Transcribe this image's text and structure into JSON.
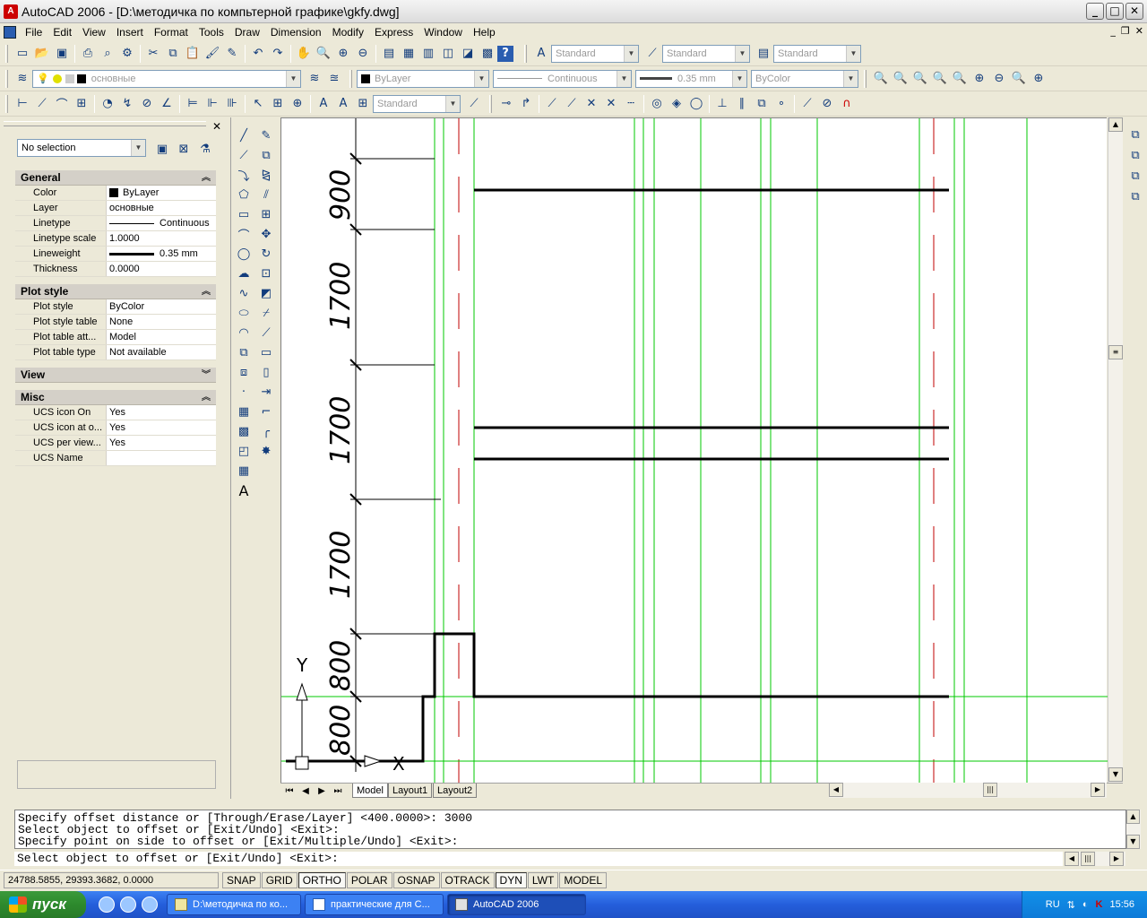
{
  "window": {
    "title": "AutoCAD 2006 - [D:\\методичка по компьтерной графике\\gkfy.dwg]",
    "app_icon": "A"
  },
  "menu": [
    "File",
    "Edit",
    "View",
    "Insert",
    "Format",
    "Tools",
    "Draw",
    "Dimension",
    "Modify",
    "Express",
    "Window",
    "Help"
  ],
  "styles_toolbar": {
    "text_style": "Standard",
    "dim_style": "Standard",
    "table_style": "Standard"
  },
  "layers_toolbar": {
    "layer": "основные"
  },
  "properties_toolbar": {
    "color": "ByLayer",
    "linetype": "Continuous",
    "lineweight": "0.35 mm",
    "plotstyle": "ByColor"
  },
  "dim_toolbar": {
    "dim_style": "Standard"
  },
  "properties_palette": {
    "selection": "No selection",
    "general": {
      "title": "General",
      "rows": [
        {
          "k": "Color",
          "v": "ByLayer"
        },
        {
          "k": "Layer",
          "v": "основные"
        },
        {
          "k": "Linetype",
          "v": "Continuous"
        },
        {
          "k": "Linetype scale",
          "v": "1.0000"
        },
        {
          "k": "Lineweight",
          "v": "0.35 mm"
        },
        {
          "k": "Thickness",
          "v": "0.0000"
        }
      ]
    },
    "plot": {
      "title": "Plot style",
      "rows": [
        {
          "k": "Plot style",
          "v": "ByColor"
        },
        {
          "k": "Plot style table",
          "v": "None"
        },
        {
          "k": "Plot table att...",
          "v": "Model"
        },
        {
          "k": "Plot table type",
          "v": "Not available"
        }
      ]
    },
    "view": {
      "title": "View"
    },
    "misc": {
      "title": "Misc",
      "rows": [
        {
          "k": "UCS icon On",
          "v": "Yes"
        },
        {
          "k": "UCS icon at o...",
          "v": "Yes"
        },
        {
          "k": "UCS per view...",
          "v": "Yes"
        },
        {
          "k": "UCS Name",
          "v": ""
        }
      ]
    }
  },
  "drawing": {
    "dims": [
      "900",
      "1700",
      "1700",
      "1700",
      "800",
      "800"
    ],
    "ucs": {
      "y": "Y",
      "x": "X"
    },
    "colors": {
      "lines": "#000000",
      "grid": "#00c800",
      "axis": "#c00000"
    }
  },
  "layout_tabs": [
    "Model",
    "Layout1",
    "Layout2"
  ],
  "command": {
    "history": [
      "Specify offset distance or [Through/Erase/Layer] <400.0000>: 3000",
      "Select object to offset or [Exit/Undo] <Exit>:",
      "Specify point on side to offset or [Exit/Multiple/Undo] <Exit>:"
    ],
    "prompt": "Select object to offset or [Exit/Undo] <Exit>:"
  },
  "status": {
    "coords": "24788.5855, 29393.3682, 0.0000",
    "buttons": [
      {
        "label": "SNAP",
        "on": false
      },
      {
        "label": "GRID",
        "on": false
      },
      {
        "label": "ORTHO",
        "on": true
      },
      {
        "label": "POLAR",
        "on": false
      },
      {
        "label": "OSNAP",
        "on": false
      },
      {
        "label": "OTRACK",
        "on": false
      },
      {
        "label": "DYN",
        "on": true
      },
      {
        "label": "LWT",
        "on": false
      },
      {
        "label": "MODEL",
        "on": false
      }
    ]
  },
  "taskbar": {
    "start": "пуск",
    "tasks": [
      "D:\\методичка по ко...",
      "практические для С...",
      "AutoCAD 2006"
    ],
    "lang": "RU",
    "time": "15:56"
  }
}
